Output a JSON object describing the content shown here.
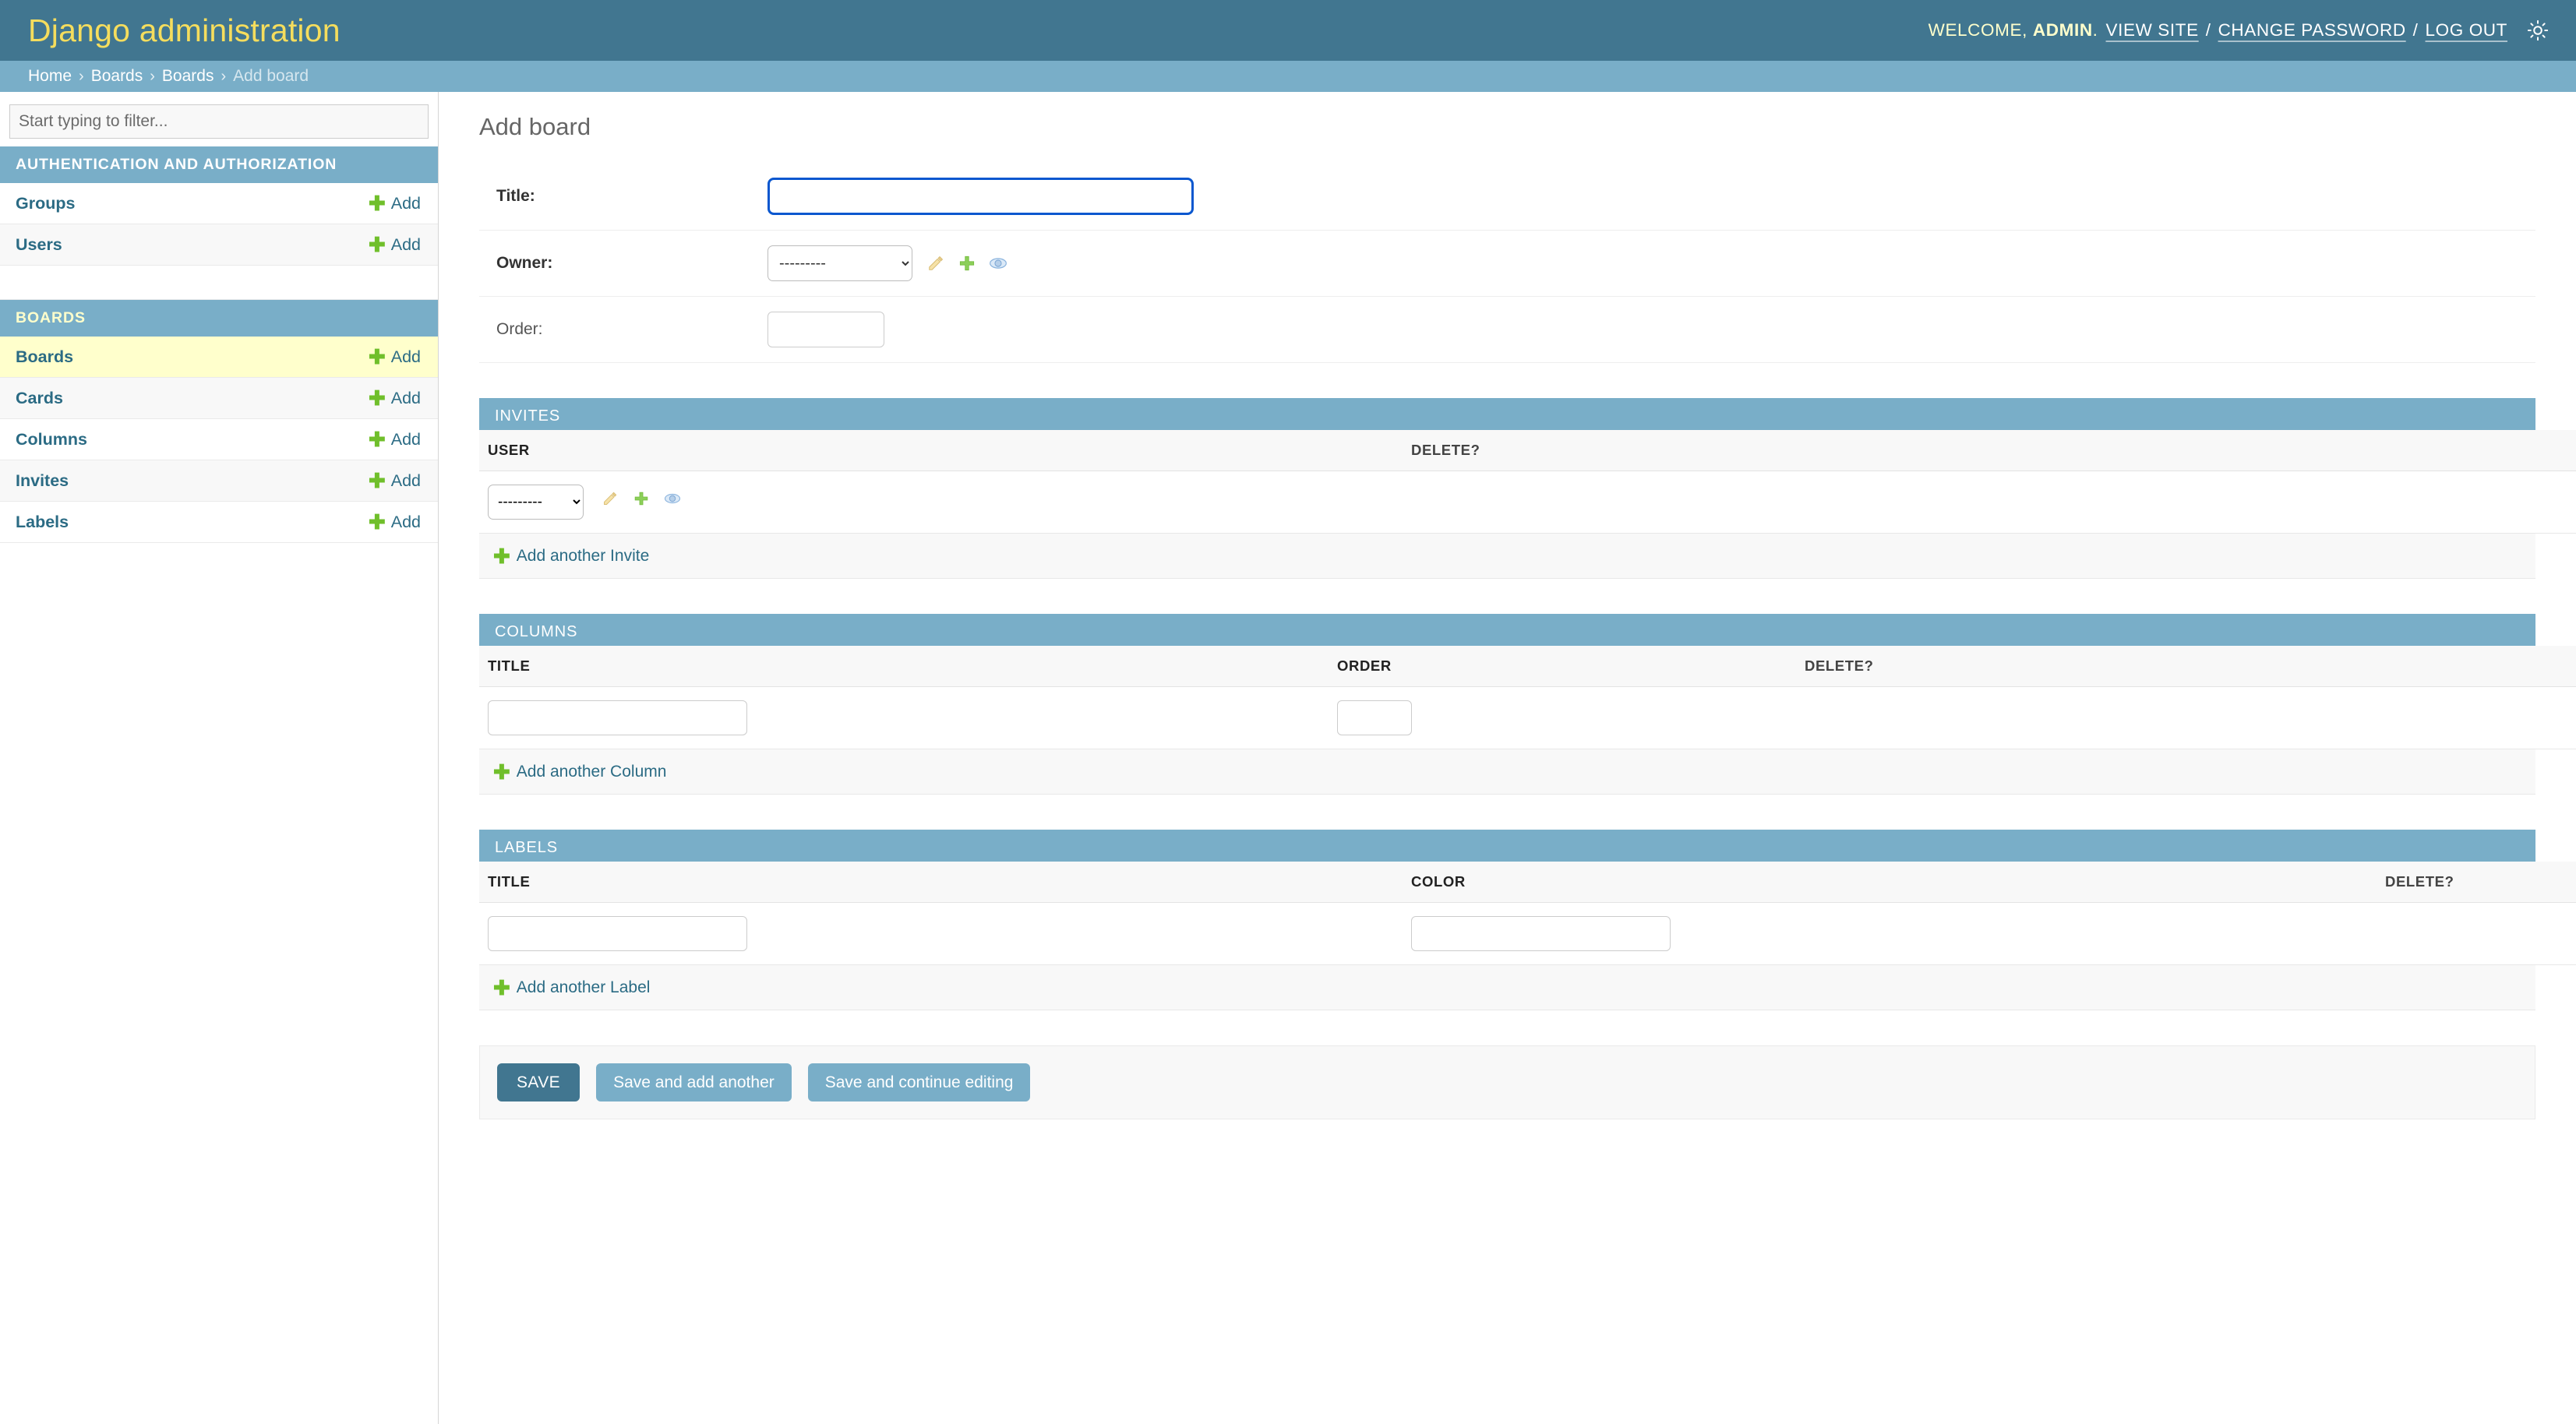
{
  "header": {
    "site_title": "Django administration",
    "welcome_text": "WELCOME,",
    "user_name": "ADMIN",
    "dot": ".",
    "view_site": "VIEW SITE",
    "separator": "/",
    "change_password": "CHANGE PASSWORD",
    "log_out": "LOG OUT",
    "theme_icon": "sun-icon",
    "bg_color": "#417690",
    "brand_color": "#f5dd5d"
  },
  "breadcrumbs": {
    "items": [
      "Home",
      "Boards",
      "Boards"
    ],
    "current": "Add board",
    "arrow": "›",
    "bg_color": "#79aec8"
  },
  "sidebar": {
    "filter_placeholder": "Start typing to filter...",
    "filter_value": "",
    "apps": [
      {
        "caption": "AUTHENTICATION AND AUTHORIZATION",
        "current": false,
        "models": [
          {
            "label": "Groups",
            "add_label": "Add",
            "current": false
          },
          {
            "label": "Users",
            "add_label": "Add",
            "current": false
          }
        ]
      },
      {
        "caption": "BOARDS",
        "current": true,
        "models": [
          {
            "label": "Boards",
            "add_label": "Add",
            "current": true
          },
          {
            "label": "Cards",
            "add_label": "Add",
            "current": false
          },
          {
            "label": "Columns",
            "add_label": "Add",
            "current": false
          },
          {
            "label": "Invites",
            "add_label": "Add",
            "current": false
          },
          {
            "label": "Labels",
            "add_label": "Add",
            "current": false
          }
        ]
      }
    ]
  },
  "main": {
    "page_title": "Add board",
    "fields": [
      {
        "label": "Title:",
        "required": true,
        "value": "",
        "focused": true
      },
      {
        "label": "Owner:",
        "required": true,
        "selected": "---------"
      },
      {
        "label": "Order:",
        "required": false,
        "value": ""
      }
    ],
    "related_icons": {
      "change": "pencil-icon",
      "add": "plus-icon",
      "view": "eye-icon"
    }
  },
  "inlines": [
    {
      "heading": "INVITES",
      "columns": [
        "USER",
        "DELETE?"
      ],
      "rows": [
        {
          "user_selected": "---------"
        }
      ],
      "add_another": "Add another Invite"
    },
    {
      "heading": "COLUMNS",
      "columns": [
        "TITLE",
        "ORDER",
        "DELETE?"
      ],
      "rows": [
        {
          "title": "",
          "order": ""
        }
      ],
      "add_another": "Add another Column"
    },
    {
      "heading": "LABELS",
      "columns": [
        "TITLE",
        "COLOR",
        "DELETE?"
      ],
      "rows": [
        {
          "title": "",
          "color": ""
        }
      ],
      "add_another": "Add another Label"
    }
  ],
  "submit_row": {
    "save": "SAVE",
    "save_and_add_another": "Save and add another",
    "save_and_continue": "Save and continue editing"
  },
  "colors": {
    "primary": "#417690",
    "secondary": "#79aec8",
    "accent": "#f5dd5d",
    "link": "#2b6b84",
    "add_green": "#70bf2b",
    "focus_blue": "#0a57cf",
    "selected_row": "#ffffcc"
  }
}
